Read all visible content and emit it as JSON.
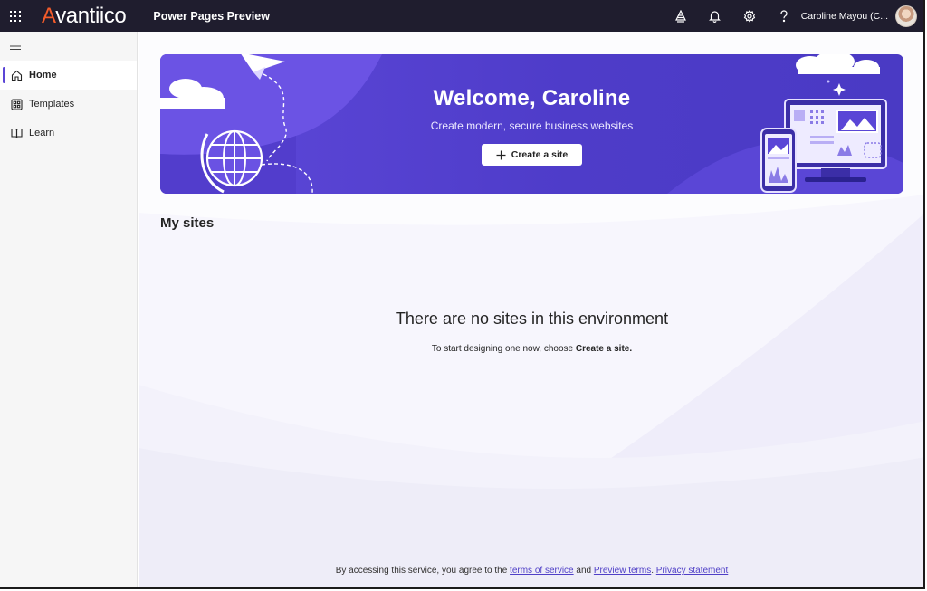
{
  "topbar": {
    "brand_initial": "A",
    "brand_rest": "vantiico",
    "app_title": "Power Pages Preview",
    "user_name": "Caroline Mayou (C...",
    "icons": [
      "waffle-icon",
      "environment-icon",
      "bell-icon",
      "gear-icon",
      "help-icon"
    ]
  },
  "sidebar": {
    "items": [
      {
        "label": "Home",
        "icon": "home-icon",
        "active": true
      },
      {
        "label": "Templates",
        "icon": "templates-icon",
        "active": false
      },
      {
        "label": "Learn",
        "icon": "book-icon",
        "active": false
      }
    ]
  },
  "hero": {
    "title": "Welcome, Caroline",
    "subtitle": "Create modern, secure business websites",
    "button_label": "Create a site"
  },
  "my_sites": {
    "title": "My sites",
    "empty_title": "There are no sites in this environment",
    "empty_prefix": "To start designing one now, choose ",
    "empty_bold": "Create a site."
  },
  "footer": {
    "prefix": "By accessing this service, you agree to the ",
    "terms_link": "terms of service",
    "and": " and ",
    "preview_link": "Preview terms",
    "sep": ". ",
    "privacy_link": "Privacy statement"
  },
  "colors": {
    "topbar": "#1f1d2e",
    "brand_accent": "#f35b2a",
    "hero": "#5441d1",
    "accent": "#5b45d6",
    "link": "#4f3fc7"
  }
}
